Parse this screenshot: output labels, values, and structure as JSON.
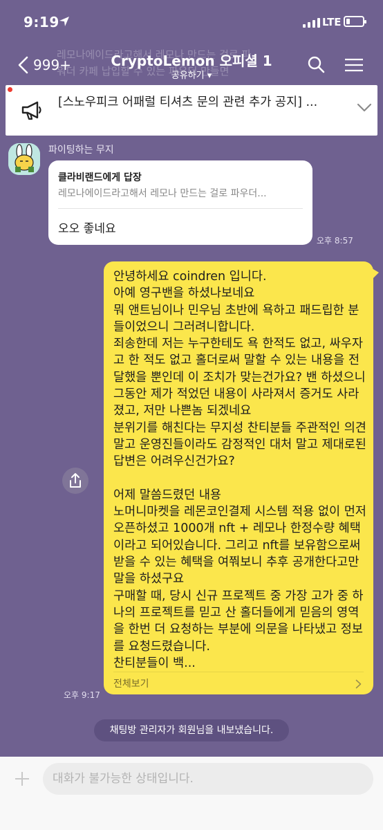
{
  "status": {
    "time": "9:19",
    "network": "LTE"
  },
  "ghost_text": [
    "레모나에이드라고해서 레모나 만드는 걸로 파",
    "워더 카페 납입할 수 있는 파우더 만들면"
  ],
  "header": {
    "back_count": "999+",
    "title": "CryptoLemon 오피셜 1",
    "subtitle": "공유하기 ▾"
  },
  "notice": {
    "text": "[스노우피크 어패럴 티셔츠 문의 관련 추가 공지] ..."
  },
  "incoming": {
    "sender": "파이팅하는 무지",
    "reply_to": "클라비랜드에게 답장",
    "reply_quote": "레모나에이드라고해서 레모나 만드는 걸로 파우더...",
    "text": "오오 좋네요",
    "time": "오후 8:57"
  },
  "outgoing": {
    "text": "안녕하세요 coindren 입니다.\n아예 영구밴을 하셨나보네요\n뭐 앤트님이나 민우님 초반에 욕하고 패드립한 분들이었으니 그러려니합니다.\n죄송한데 저는 누구한테도 욕 한적도 없고, 싸우자고 한 적도 없고 홀더로써 말할 수 있는 내용을 전달했을 뿐인데 이 조치가 맞는건가요? 밴 하셨으니 그동안 제가 적었던 내용이 사라져서 증거도 사라졌고, 저만 나쁜놈 되겠네요\n분위기를 해친다는 무지성 찬티분들 주관적인 의견 말고 운영진들이라도 감정적인 대처 말고 제대로된 답변은 어려우신건가요?\n\n어제 말씀드렸던 내용\n노머니마켓을 레몬코인결제 시스템 적용 없이 먼저 오픈하셨고 1000개 nft + 레모나 한정수량 혜택이라고 되어있습니다. 그리고 nft를 보유함으로써 받을 수 있는 혜택을 여쭤보니 추후 공개한다고만 말을 하셨구요\n구매할 때, 당시 신규 프로젝트 중 가장 고가 중 하나의 프로젝트를 믿고 산 홀더들에게 믿음의 영역을 한번 더 요청하는 부분에 의문을 나타냈고 정보를 요청드렸습니다.\n찬티분들이 백...",
    "see_all": "전체보기",
    "time": "오후 9:17"
  },
  "system_message": "채팅방 관리자가 회원님을 내보냈습니다.",
  "input": {
    "placeholder": "대화가 불가능한 상태입니다."
  },
  "colors": {
    "background": "#6f6190",
    "my_bubble": "#fbe64c",
    "other_bubble": "#ffffff"
  }
}
